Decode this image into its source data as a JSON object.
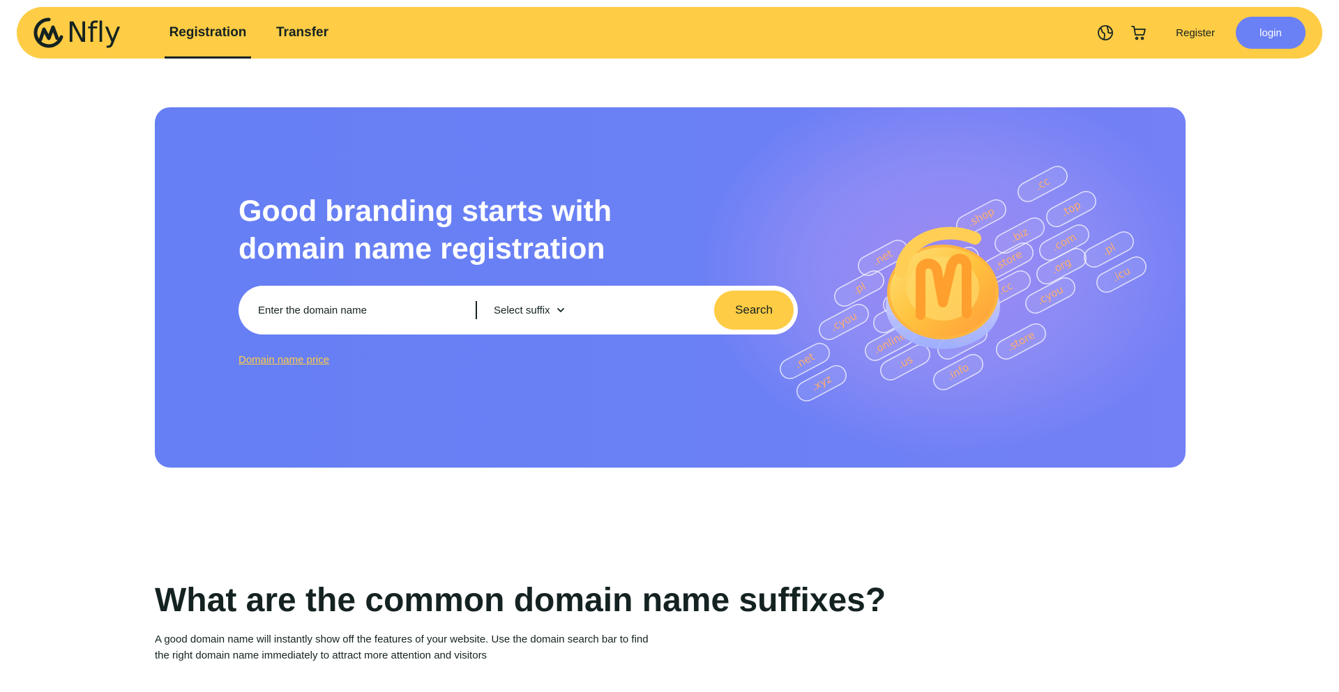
{
  "header": {
    "brand": "Nfly",
    "nav": [
      {
        "label": "Registration",
        "active": true
      },
      {
        "label": "Transfer",
        "active": false
      }
    ],
    "icons": {
      "language": "globe-icon",
      "cart": "cart-icon"
    },
    "register_label": "Register",
    "login_label": "login"
  },
  "hero": {
    "title_line1": "Good branding starts with",
    "title_line2": "domain name registration",
    "search": {
      "placeholder": "Enter the domain name",
      "value": "",
      "suffix_label": "Select suffix",
      "button_label": "Search"
    },
    "price_link": "Domain name price",
    "suffix_pills": [
      ".cc",
      ".shop",
      ".top",
      ".biz",
      ".com",
      ".store",
      ".net",
      ".pl",
      ".org",
      ".icu",
      ".us",
      ".pl",
      ".cc",
      ".cyou",
      ".org",
      ".icu",
      ".cyou",
      ".online",
      ".biz",
      ".store",
      ".net",
      ".us",
      ".info",
      ".xyz"
    ]
  },
  "section": {
    "title": "What are the common domain name suffixes?",
    "description": "A good domain name will instantly show off the features of your website. Use the domain search bar to find the right domain name immediately to attract more attention and visitors"
  },
  "colors": {
    "header_bg": "#fecc45",
    "hero_bg": "#6a80f5",
    "login_bg": "#6a80f5",
    "search_btn": "#fecc45",
    "text": "#142221"
  }
}
